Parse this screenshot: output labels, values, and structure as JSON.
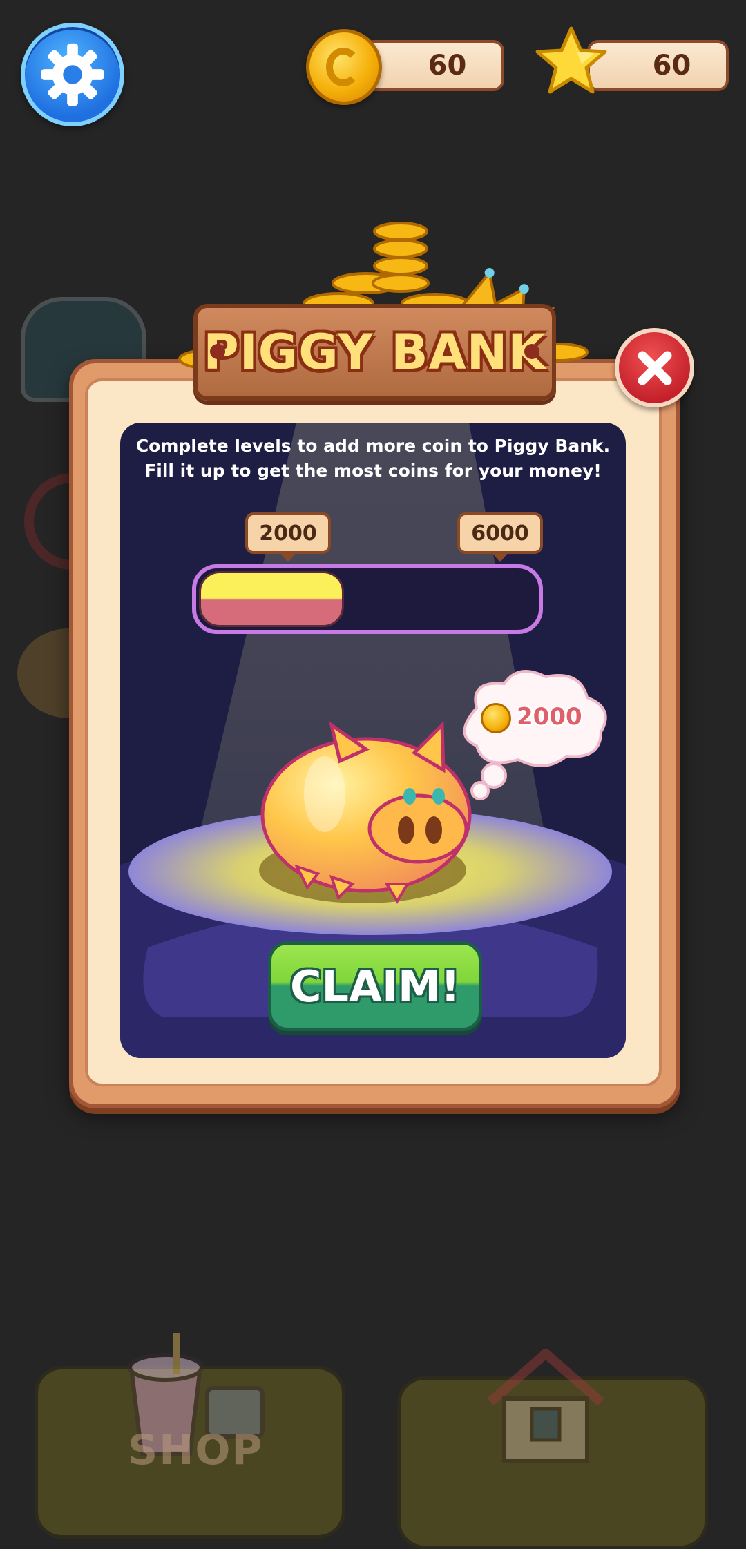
{
  "hud": {
    "coins": "60",
    "stars": "60",
    "settings_icon": "gear-icon",
    "coin_icon": "coin-icon",
    "star_icon": "star-icon"
  },
  "popup": {
    "title": "PIGGY BANK",
    "description_line1": "Complete levels to add more coin to Piggy Bank.",
    "description_line2": "Fill it up to get the most coins for your money!",
    "progress": {
      "min_label": "2000",
      "max_label": "6000",
      "fill_fraction": 0.43
    },
    "bubble_amount": "2000",
    "claim_label": "CLAIM!",
    "close_icon": "close-icon"
  },
  "background": {
    "shop_label": "SHOP"
  },
  "colors": {
    "background": "#252525",
    "popup_frame": "#e19a6a",
    "popup_panel": "#1e1e44",
    "title_text": "#ffe07a",
    "claim_button": "#7fd63a",
    "close_button": "#c21f2a",
    "progress_border": "#c77ae4"
  }
}
